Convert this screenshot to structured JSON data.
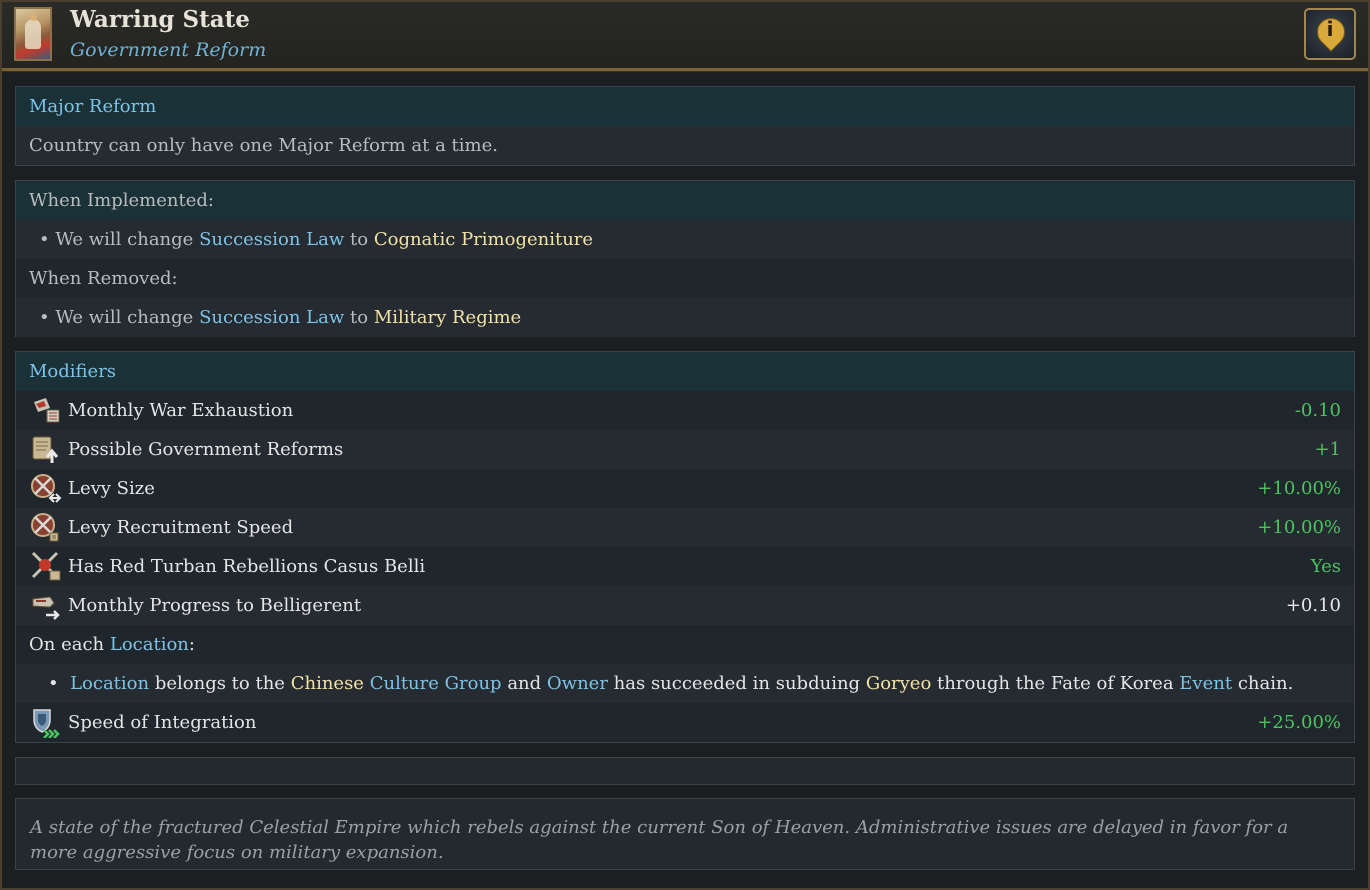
{
  "header": {
    "title": "Warring State",
    "subtitle": "Government Reform",
    "info_icon": "info-icon"
  },
  "major_reform": {
    "heading": "Major Reform",
    "text": "Country can only have one Major Reform at a time."
  },
  "effects": {
    "implemented_label": "When Implemented:",
    "implemented": {
      "prefix": "• We will change",
      "law": "Succession Law",
      "mid": "to",
      "target": "Cognatic Primogeniture"
    },
    "removed_label": "When Removed:",
    "removed": {
      "prefix": "• We will change",
      "law": "Succession Law",
      "mid": "to",
      "target": "Military Regime"
    }
  },
  "modifiers": {
    "heading": "Modifiers",
    "items": [
      {
        "icon": "war-exhaustion-icon",
        "label": "Monthly War Exhaustion",
        "value": "-0.10",
        "color": "#4cc35f"
      },
      {
        "icon": "government-reforms-icon",
        "label": "Possible Government Reforms",
        "value": "+1",
        "color": "#4cc35f"
      },
      {
        "icon": "levy-size-icon",
        "label": "Levy Size",
        "value": "+10.00%",
        "color": "#4cc35f"
      },
      {
        "icon": "levy-recruitment-icon",
        "label": "Levy Recruitment Speed",
        "value": "+10.00%",
        "color": "#4cc35f"
      },
      {
        "icon": "casus-belli-icon",
        "label": "Has Red Turban Rebellions Casus Belli",
        "value": "Yes",
        "color": "#4cc35f"
      },
      {
        "icon": "belligerent-progress-icon",
        "label": "Monthly Progress to Belligerent",
        "value": "+0.10",
        "color": "#e4e6e6"
      }
    ],
    "location": {
      "prefix": "On each",
      "link": "Location",
      "suffix": ":",
      "bullet": "•",
      "c1": "Location",
      "c2": "belongs to the",
      "c3": "Chinese",
      "c4": "Culture Group",
      "c5": "and",
      "c6": "Owner",
      "c7": "has succeeded in subduing",
      "c8": "Goryeo",
      "c9": "through the Fate of Korea",
      "c10": "Event",
      "c11": "chain."
    },
    "integration": {
      "icon": "integration-speed-icon",
      "label": "Speed of Integration",
      "value": "+25.00%"
    }
  },
  "description": "A state of the fractured Celestial Empire which rebels against the current Son of Heaven. Administrative issues are delayed in favor for a more aggressive focus on military expansion."
}
